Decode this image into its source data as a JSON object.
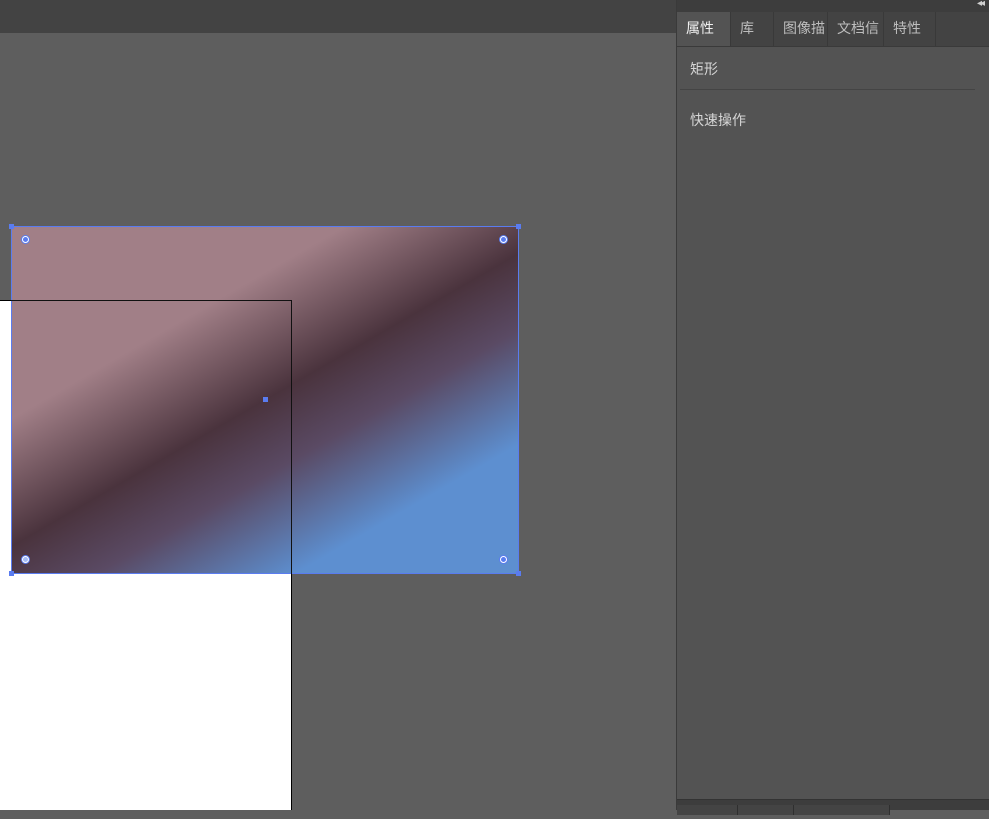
{
  "panel": {
    "tabs": [
      {
        "label": "属性",
        "active": true
      },
      {
        "label": "库",
        "active": false
      },
      {
        "label": "图像描",
        "active": false
      },
      {
        "label": "文档信",
        "active": false
      },
      {
        "label": "特性",
        "active": false
      }
    ],
    "object_type": "矩形",
    "quick_actions": "快速操作",
    "collapse_icon": "double-chevron-left-icon"
  },
  "colors": {
    "selection": "#5a7cf0",
    "gradient_pink": "#a17f87",
    "gradient_dark": "#4a333d",
    "gradient_blue": "#5d8fd0"
  }
}
